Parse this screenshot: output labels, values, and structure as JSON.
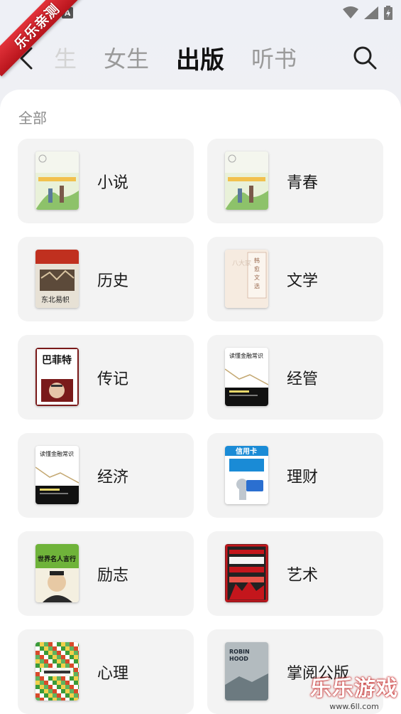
{
  "status_bar": {
    "badge": "A",
    "icons": [
      "wifi-icon",
      "signal-icon",
      "battery-icon"
    ]
  },
  "watermark": {
    "ribbon": "乐乐亲测",
    "logo": "乐乐游戏",
    "url": "www.6ll.com"
  },
  "nav": {
    "tabs": [
      {
        "label": "生",
        "state": "faded"
      },
      {
        "label": "女生",
        "state": "normal"
      },
      {
        "label": "出版",
        "state": "active"
      },
      {
        "label": "听书",
        "state": "normal"
      }
    ]
  },
  "section": {
    "title": "全部"
  },
  "categories": [
    {
      "label": "小说",
      "cover_icon": "book-cover-illustrated-couple",
      "cover_colors": [
        "#e9f1d9",
        "#8dc26a",
        "#f2c14e"
      ]
    },
    {
      "label": "青春",
      "cover_icon": "book-cover-illustrated-couple",
      "cover_colors": [
        "#e9f1d9",
        "#8dc26a",
        "#f2c14e"
      ]
    },
    {
      "label": "历史",
      "cover_icon": "book-cover-northeast",
      "cover_text": "东北易帜",
      "cover_colors": [
        "#c0301f",
        "#5c4a3a",
        "#e7e1d5"
      ]
    },
    {
      "label": "文学",
      "cover_icon": "book-cover-literature",
      "cover_text": "韩愈文选",
      "cover_colors": [
        "#f6ebe0",
        "#9a6a4f"
      ]
    },
    {
      "label": "传记",
      "cover_icon": "book-cover-buffett",
      "cover_text": "巴菲特",
      "cover_colors": [
        "#ffffff",
        "#7a1a1a"
      ]
    },
    {
      "label": "经管",
      "cover_icon": "book-cover-finance",
      "cover_text": "读懂金融常识",
      "cover_colors": [
        "#ffffff",
        "#111111"
      ]
    },
    {
      "label": "经济",
      "cover_icon": "book-cover-finance",
      "cover_text": "读懂金融常识",
      "cover_colors": [
        "#ffffff",
        "#111111"
      ]
    },
    {
      "label": "理财",
      "cover_icon": "book-cover-credit-card",
      "cover_text": "信用卡",
      "cover_colors": [
        "#1a8bd6",
        "#ffffff"
      ]
    },
    {
      "label": "励志",
      "cover_icon": "book-cover-famous-quotes",
      "cover_text": "世界名人言行",
      "cover_colors": [
        "#6fb33a",
        "#f4efe0"
      ]
    },
    {
      "label": "艺术",
      "cover_icon": "book-cover-art",
      "cover_colors": [
        "#c4161c",
        "#222222"
      ]
    },
    {
      "label": "心理",
      "cover_icon": "book-cover-mosaic",
      "cover_colors": [
        "#3a9b3a",
        "#d84a2a",
        "#f2d04a"
      ]
    },
    {
      "label": "掌阅公版",
      "cover_icon": "book-cover-robin-hood",
      "cover_text": "ROBIN HOOD",
      "cover_colors": [
        "#8e9a9e",
        "#d9dde0"
      ]
    }
  ]
}
